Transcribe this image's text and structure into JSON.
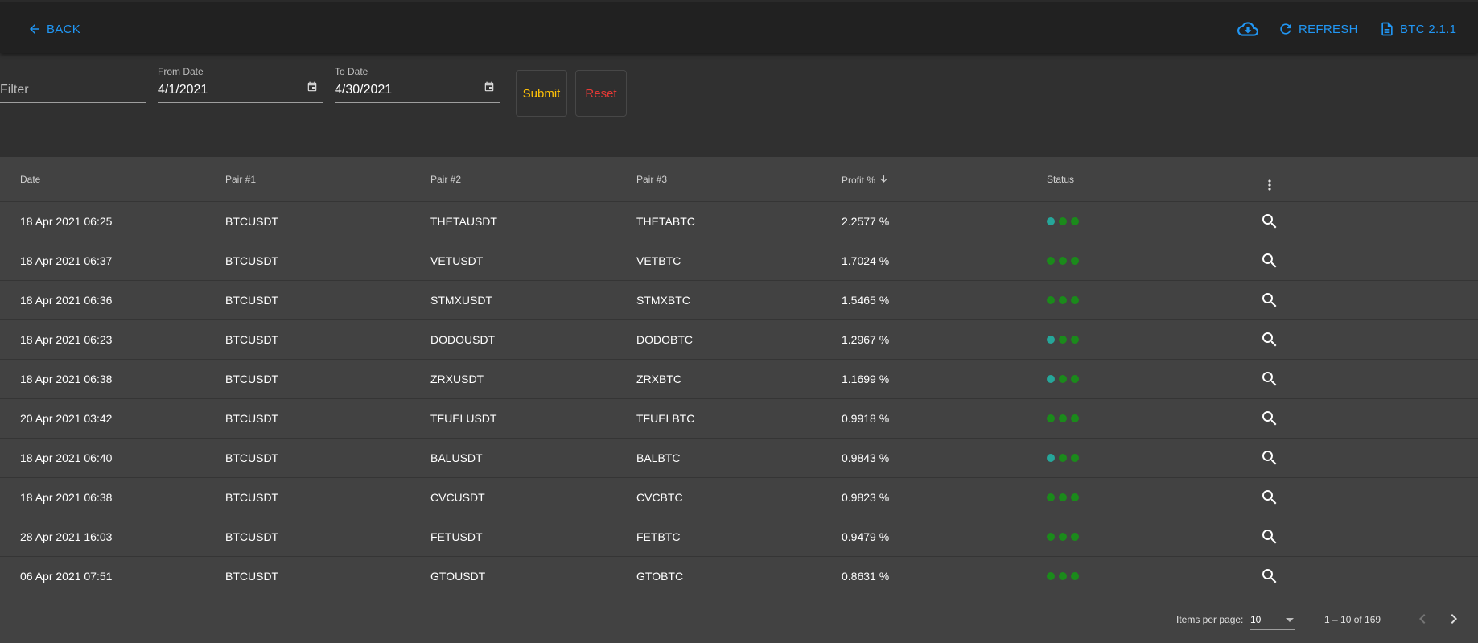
{
  "toolbar": {
    "back_label": "BACK",
    "refresh_label": "REFRESH",
    "version_label": "BTC 2.1.1",
    "accent_color": "#2196f3"
  },
  "filters": {
    "filter_placeholder": "Filter",
    "filter_value": "",
    "from_label": "From Date",
    "from_value": "4/1/2021",
    "to_label": "To Date",
    "to_value": "4/30/2021",
    "submit_label": "Submit",
    "reset_label": "Reset"
  },
  "table": {
    "columns": [
      "Date",
      "Pair #1",
      "Pair #2",
      "Pair #3",
      "Profit %",
      "Status"
    ],
    "sort_column": "Profit %",
    "sort_direction": "descending",
    "status_colors": {
      "teal": "#26a69a",
      "green": "#1b8a1b"
    },
    "rows": [
      {
        "date": "18 Apr 2021 06:25",
        "pair1": "BTCUSDT",
        "pair2": "THETAUSDT",
        "pair3": "THETABTC",
        "profit": "2.2577 %",
        "status": [
          "teal",
          "green",
          "green"
        ]
      },
      {
        "date": "18 Apr 2021 06:37",
        "pair1": "BTCUSDT",
        "pair2": "VETUSDT",
        "pair3": "VETBTC",
        "profit": "1.7024 %",
        "status": [
          "green",
          "green",
          "green"
        ]
      },
      {
        "date": "18 Apr 2021 06:36",
        "pair1": "BTCUSDT",
        "pair2": "STMXUSDT",
        "pair3": "STMXBTC",
        "profit": "1.5465 %",
        "status": [
          "green",
          "green",
          "green"
        ]
      },
      {
        "date": "18 Apr 2021 06:23",
        "pair1": "BTCUSDT",
        "pair2": "DODOUSDT",
        "pair3": "DODOBTC",
        "profit": "1.2967 %",
        "status": [
          "teal",
          "green",
          "green"
        ]
      },
      {
        "date": "18 Apr 2021 06:38",
        "pair1": "BTCUSDT",
        "pair2": "ZRXUSDT",
        "pair3": "ZRXBTC",
        "profit": "1.1699 %",
        "status": [
          "teal",
          "green",
          "green"
        ]
      },
      {
        "date": "20 Apr 2021 03:42",
        "pair1": "BTCUSDT",
        "pair2": "TFUELUSDT",
        "pair3": "TFUELBTC",
        "profit": "0.9918 %",
        "status": [
          "green",
          "green",
          "green"
        ]
      },
      {
        "date": "18 Apr 2021 06:40",
        "pair1": "BTCUSDT",
        "pair2": "BALUSDT",
        "pair3": "BALBTC",
        "profit": "0.9843 %",
        "status": [
          "teal",
          "green",
          "green"
        ]
      },
      {
        "date": "18 Apr 2021 06:38",
        "pair1": "BTCUSDT",
        "pair2": "CVCUSDT",
        "pair3": "CVCBTC",
        "profit": "0.9823 %",
        "status": [
          "green",
          "green",
          "green"
        ]
      },
      {
        "date": "28 Apr 2021 16:03",
        "pair1": "BTCUSDT",
        "pair2": "FETUSDT",
        "pair3": "FETBTC",
        "profit": "0.9479 %",
        "status": [
          "green",
          "green",
          "green"
        ]
      },
      {
        "date": "06 Apr 2021 07:51",
        "pair1": "BTCUSDT",
        "pair2": "GTOUSDT",
        "pair3": "GTOBTC",
        "profit": "0.8631 %",
        "status": [
          "green",
          "green",
          "green"
        ]
      }
    ]
  },
  "paginator": {
    "items_per_page_label": "Items per page:",
    "items_per_page_value": "10",
    "range_label": "1 – 10 of 169"
  }
}
